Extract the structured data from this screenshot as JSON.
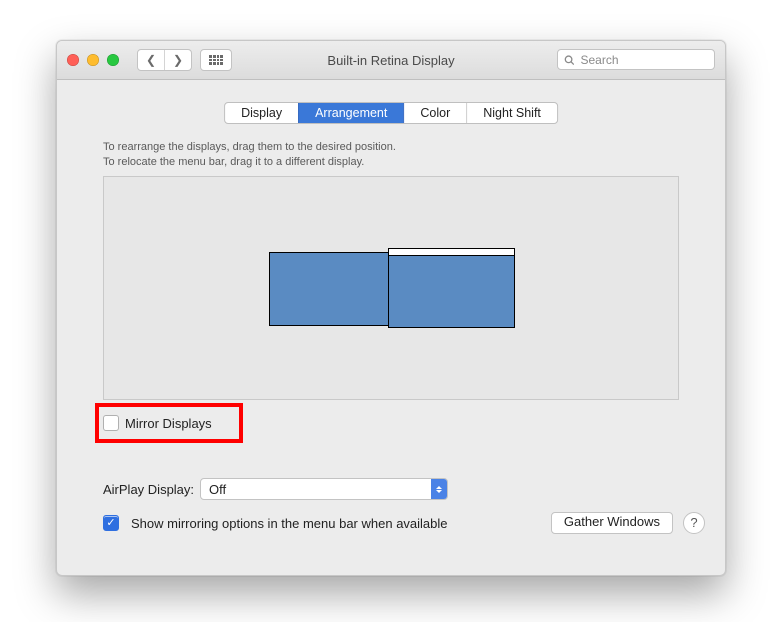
{
  "title": "Built-in Retina Display",
  "search_placeholder": "Search",
  "tabs": {
    "display": "Display",
    "arrangement": "Arrangement",
    "color": "Color",
    "night_shift": "Night Shift"
  },
  "hint_line1": "To rearrange the displays, drag them to the desired position.",
  "hint_line2": "To relocate the menu bar, drag it to a different display.",
  "mirror_label": "Mirror Displays",
  "airplay_label": "AirPlay Display:",
  "airplay_value": "Off",
  "show_mirroring_label": "Show mirroring options in the menu bar when available",
  "gather_label": "Gather Windows",
  "help_label": "?"
}
